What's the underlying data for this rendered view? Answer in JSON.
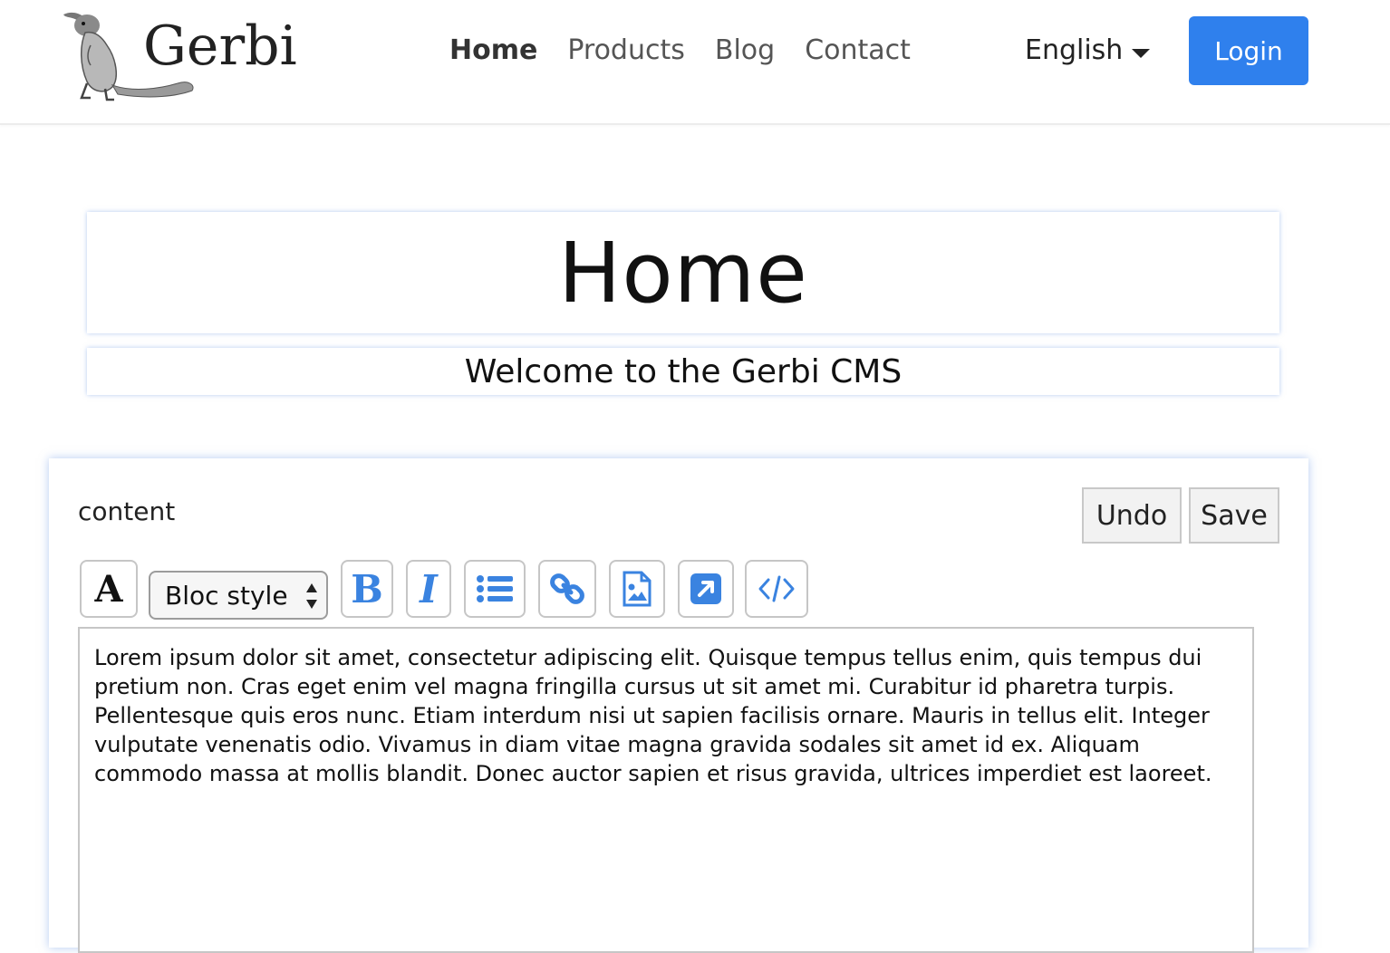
{
  "header": {
    "logo_text": "Gerbi",
    "nav": [
      {
        "label": "Home",
        "active": true
      },
      {
        "label": "Products",
        "active": false
      },
      {
        "label": "Blog",
        "active": false
      },
      {
        "label": "Contact",
        "active": false
      }
    ],
    "language": "English",
    "login_label": "Login"
  },
  "page": {
    "title": "Home",
    "subtitle": "Welcome to the Gerbi CMS"
  },
  "editor": {
    "label": "content",
    "undo_label": "Undo",
    "save_label": "Save",
    "toolbar": {
      "font_glyph": "A",
      "bloc_style_label": "Bloc style",
      "bold_glyph": "B",
      "italic_glyph": "I",
      "icons": [
        "font-icon",
        "bold-icon",
        "italic-icon",
        "list-icon",
        "link-icon",
        "image-icon",
        "external-link-icon",
        "code-icon"
      ]
    },
    "content": "Lorem ipsum dolor sit amet, consectetur adipiscing elit. Quisque tempus tellus enim, quis tempus dui pretium non. Cras eget enim vel magna fringilla cursus ut sit amet mi. Curabitur id pharetra turpis. Pellentesque quis eros nunc. Etiam interdum nisi ut sapien facilisis ornare. Mauris in tellus elit. Integer vulputate venenatis odio. Vivamus in diam vitae magna gravida sodales sit amet id ex. Aliquam commodo massa at mollis blandit. Donec auctor sapien et risus gravida, ultrices imperdiet est laoreet."
  },
  "colors": {
    "accent": "#2f80ed",
    "icon_blue": "#3a83e0"
  }
}
